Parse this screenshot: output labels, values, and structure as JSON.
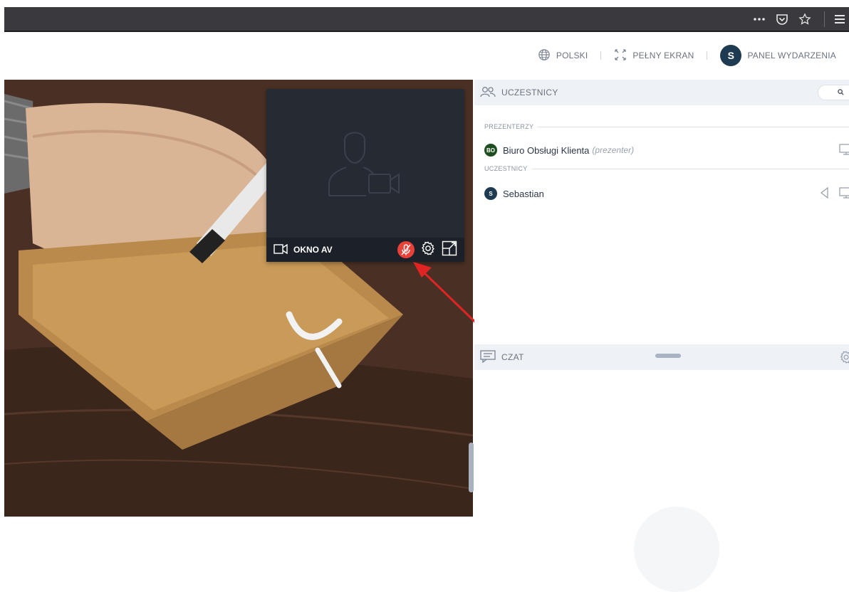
{
  "browser": {
    "more_icon": "ellipsis-icon",
    "pocket_icon": "pocket-icon",
    "bookmark_icon": "star-icon",
    "menu_icon": "hamburger-icon"
  },
  "topnav": {
    "language_label": "POLSKI",
    "fullscreen_label": "PEŁNY EKRAN",
    "event_panel_label": "PANEL WYDARZENIA",
    "user_initial": "S"
  },
  "av_window": {
    "title": "OKNO AV",
    "mic_state": "muted",
    "mic_color": "#e8413a"
  },
  "participants_panel": {
    "title": "UCZESTNICY",
    "sections": [
      {
        "label": "PREZENTERZY",
        "people": [
          {
            "initials": "BO",
            "name": "Biuro Obsługi Klienta",
            "role": "(prezenter)",
            "badge_color": "#1e4d20"
          }
        ]
      },
      {
        "label": "UCZESTNICY",
        "people": [
          {
            "initials": "S",
            "name": "Sebastian",
            "role": "",
            "badge_color": "#1f3b52"
          }
        ]
      }
    ]
  },
  "chat_panel": {
    "title": "CZAT"
  },
  "colors": {
    "annotation_arrow": "#e02424",
    "panel_header_bg": "#eef1f5",
    "av_bg": "#252a33"
  }
}
